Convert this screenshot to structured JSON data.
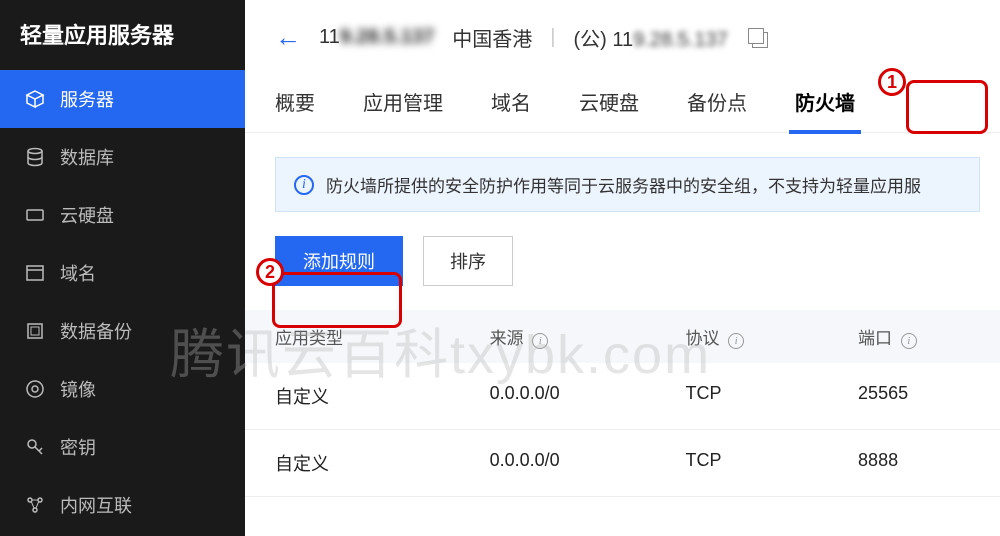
{
  "sidebar": {
    "title": "轻量应用服务器",
    "items": [
      {
        "label": "服务器"
      },
      {
        "label": "数据库"
      },
      {
        "label": "云硬盘"
      },
      {
        "label": "域名"
      },
      {
        "label": "数据备份"
      },
      {
        "label": "镜像"
      },
      {
        "label": "密钥"
      },
      {
        "label": "内网互联"
      }
    ]
  },
  "header": {
    "instance_id_prefix": "11",
    "instance_id_blur": "9.28.5.137",
    "region": "中国香港",
    "ip_label": "(公)",
    "ip_prefix": "11",
    "ip_blur": "9.28.5.137"
  },
  "tabs": [
    {
      "label": "概要"
    },
    {
      "label": "应用管理"
    },
    {
      "label": "域名"
    },
    {
      "label": "云硬盘"
    },
    {
      "label": "备份点"
    },
    {
      "label": "防火墙"
    }
  ],
  "info": {
    "text": "防火墙所提供的安全防护作用等同于云服务器中的安全组，不支持为轻量应用服"
  },
  "actions": {
    "add_rule": "添加规则",
    "sort": "排序"
  },
  "table": {
    "headers": {
      "app_type": "应用类型",
      "source": "来源",
      "protocol": "协议",
      "port": "端口"
    },
    "rows": [
      {
        "app_type": "自定义",
        "source": "0.0.0.0/0",
        "protocol": "TCP",
        "port": "25565"
      },
      {
        "app_type": "自定义",
        "source": "0.0.0.0/0",
        "protocol": "TCP",
        "port": "8888"
      }
    ]
  },
  "callouts": {
    "one": "1",
    "two": "2"
  },
  "watermark": "腾讯云百科txybk.com"
}
